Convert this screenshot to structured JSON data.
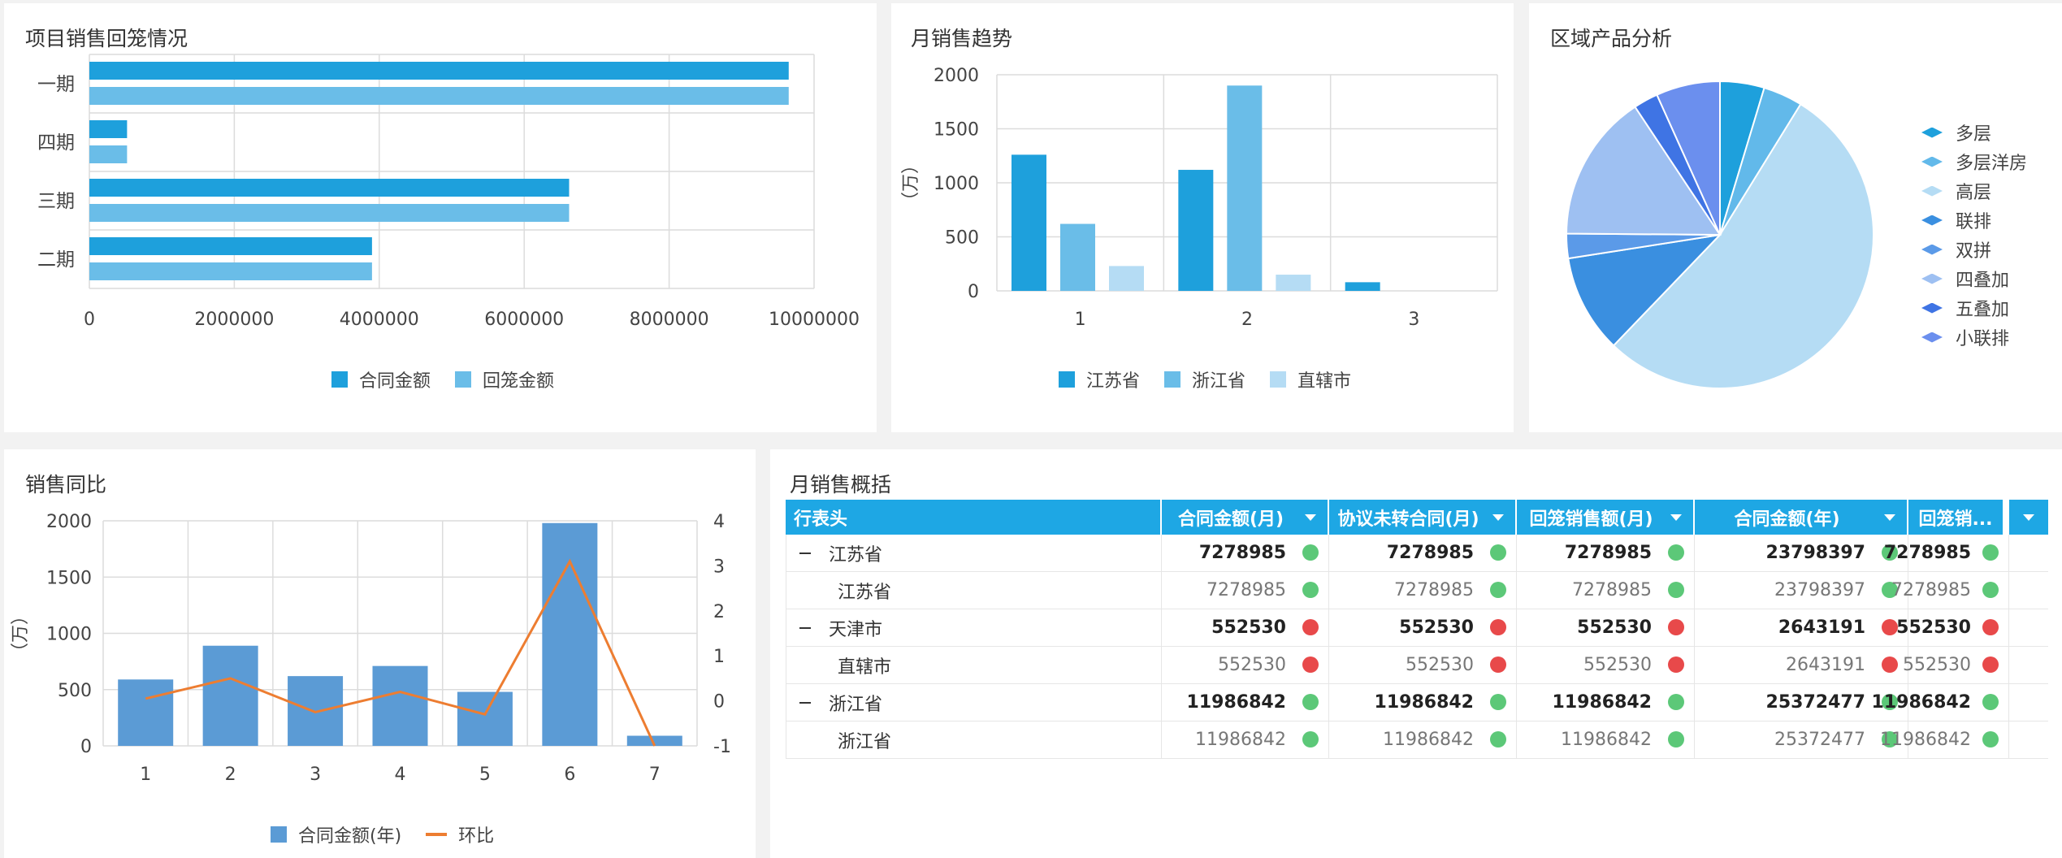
{
  "panels": {
    "p1": {
      "title": "项目销售回笼情况"
    },
    "p2": {
      "title": "月销售趋势"
    },
    "p3": {
      "title": "区域产品分析"
    },
    "p4": {
      "title": "销售同比"
    },
    "p5": {
      "title": "月销售概括"
    }
  },
  "chart_data": [
    {
      "type": "bar",
      "orientation": "horizontal",
      "title": "项目销售回笼情况",
      "categories": [
        "一期",
        "四期",
        "三期",
        "二期"
      ],
      "series": [
        {
          "name": "合同金额",
          "values": [
            9650000,
            520000,
            6620000,
            3900000
          ],
          "color": "#1ea0dc"
        },
        {
          "name": "回笼金额",
          "values": [
            9650000,
            520000,
            6620000,
            3900000
          ],
          "color": "#6abde8"
        }
      ],
      "xlim": [
        0,
        10000000
      ],
      "xticks": [
        "0",
        "2000000",
        "4000000",
        "6000000",
        "8000000",
        "10000000"
      ],
      "grid": true,
      "legend": "bottom"
    },
    {
      "type": "bar",
      "title": "月销售趋势",
      "categories": [
        "1",
        "2",
        "3"
      ],
      "series": [
        {
          "name": "江苏省",
          "values": [
            1260,
            1120,
            80
          ],
          "color": "#1ea0dc"
        },
        {
          "name": "浙江省",
          "values": [
            620,
            1900,
            0
          ],
          "color": "#6abde8"
        },
        {
          "name": "直辖市",
          "values": [
            230,
            150,
            0
          ],
          "color": "#b5dcf4"
        }
      ],
      "ylabel": "（万）",
      "ylim": [
        0,
        2000
      ],
      "yticks": [
        "0",
        "500",
        "1000",
        "1500",
        "2000"
      ],
      "grid": true,
      "legend": "bottom"
    },
    {
      "type": "pie",
      "title": "区域产品分析",
      "categories": [
        "多层",
        "多层洋房",
        "高层",
        "联排",
        "双拼",
        "四叠加",
        "五叠加",
        "小联排"
      ],
      "values": [
        4.5,
        4.0,
        51.5,
        10.0,
        2.5,
        15.0,
        2.5,
        6.5
      ],
      "colors": [
        "#1ea0dc",
        "#62b9ea",
        "#b5dcf4",
        "#3a8fe0",
        "#5b9ae8",
        "#9ec0f2",
        "#3f74e4",
        "#6b8fee"
      ],
      "legend": "right"
    },
    {
      "type": "bar",
      "title": "销售同比",
      "categories": [
        "1",
        "2",
        "3",
        "4",
        "5",
        "6",
        "7"
      ],
      "series": [
        {
          "name": "合同金额(年)",
          "type": "bar",
          "values": [
            590,
            890,
            620,
            710,
            480,
            1980,
            90
          ],
          "color": "#5b9bd5"
        },
        {
          "name": "环比",
          "type": "line",
          "axis": "right",
          "values": [
            0.05,
            0.5,
            -0.25,
            0.2,
            -0.3,
            3.1,
            -1.0
          ],
          "color": "#ed7d31"
        }
      ],
      "ylabel": "（万）",
      "ylim": [
        0,
        2000
      ],
      "yticks": [
        "0",
        "500",
        "1000",
        "1500",
        "2000"
      ],
      "y2lim": [
        -1,
        4
      ],
      "y2ticks": [
        "-1",
        "0",
        "1",
        "2",
        "3",
        "4"
      ],
      "grid": true,
      "legend": "bottom"
    }
  ],
  "table": {
    "headers": [
      "行表头",
      "合同金额(月)",
      "协议未转合同(月)",
      "回笼销售额(月)",
      "合同金额(年)",
      "回笼销..."
    ],
    "rows": [
      {
        "level": "group",
        "label": "江苏省",
        "cells": [
          "7278985",
          "7278985",
          "7278985",
          "23798397",
          "7278985"
        ],
        "status": "green"
      },
      {
        "level": "child",
        "label": "江苏省",
        "cells": [
          "7278985",
          "7278985",
          "7278985",
          "23798397",
          "7278985"
        ],
        "status": "green"
      },
      {
        "level": "group",
        "label": "天津市",
        "cells": [
          "552530",
          "552530",
          "552530",
          "2643191",
          "552530"
        ],
        "status": "red"
      },
      {
        "level": "child",
        "label": "直辖市",
        "cells": [
          "552530",
          "552530",
          "552530",
          "2643191",
          "552530"
        ],
        "status": "red"
      },
      {
        "level": "group",
        "label": "浙江省",
        "cells": [
          "11986842",
          "11986842",
          "11986842",
          "25372477",
          "11986842"
        ],
        "status": "green"
      },
      {
        "level": "child",
        "label": "浙江省",
        "cells": [
          "11986842",
          "11986842",
          "11986842",
          "25372477",
          "11986842"
        ],
        "status": "green"
      }
    ],
    "status_colors": {
      "green": "#5cc878",
      "red": "#e8494a"
    },
    "header_color": "#1ea7e4"
  }
}
